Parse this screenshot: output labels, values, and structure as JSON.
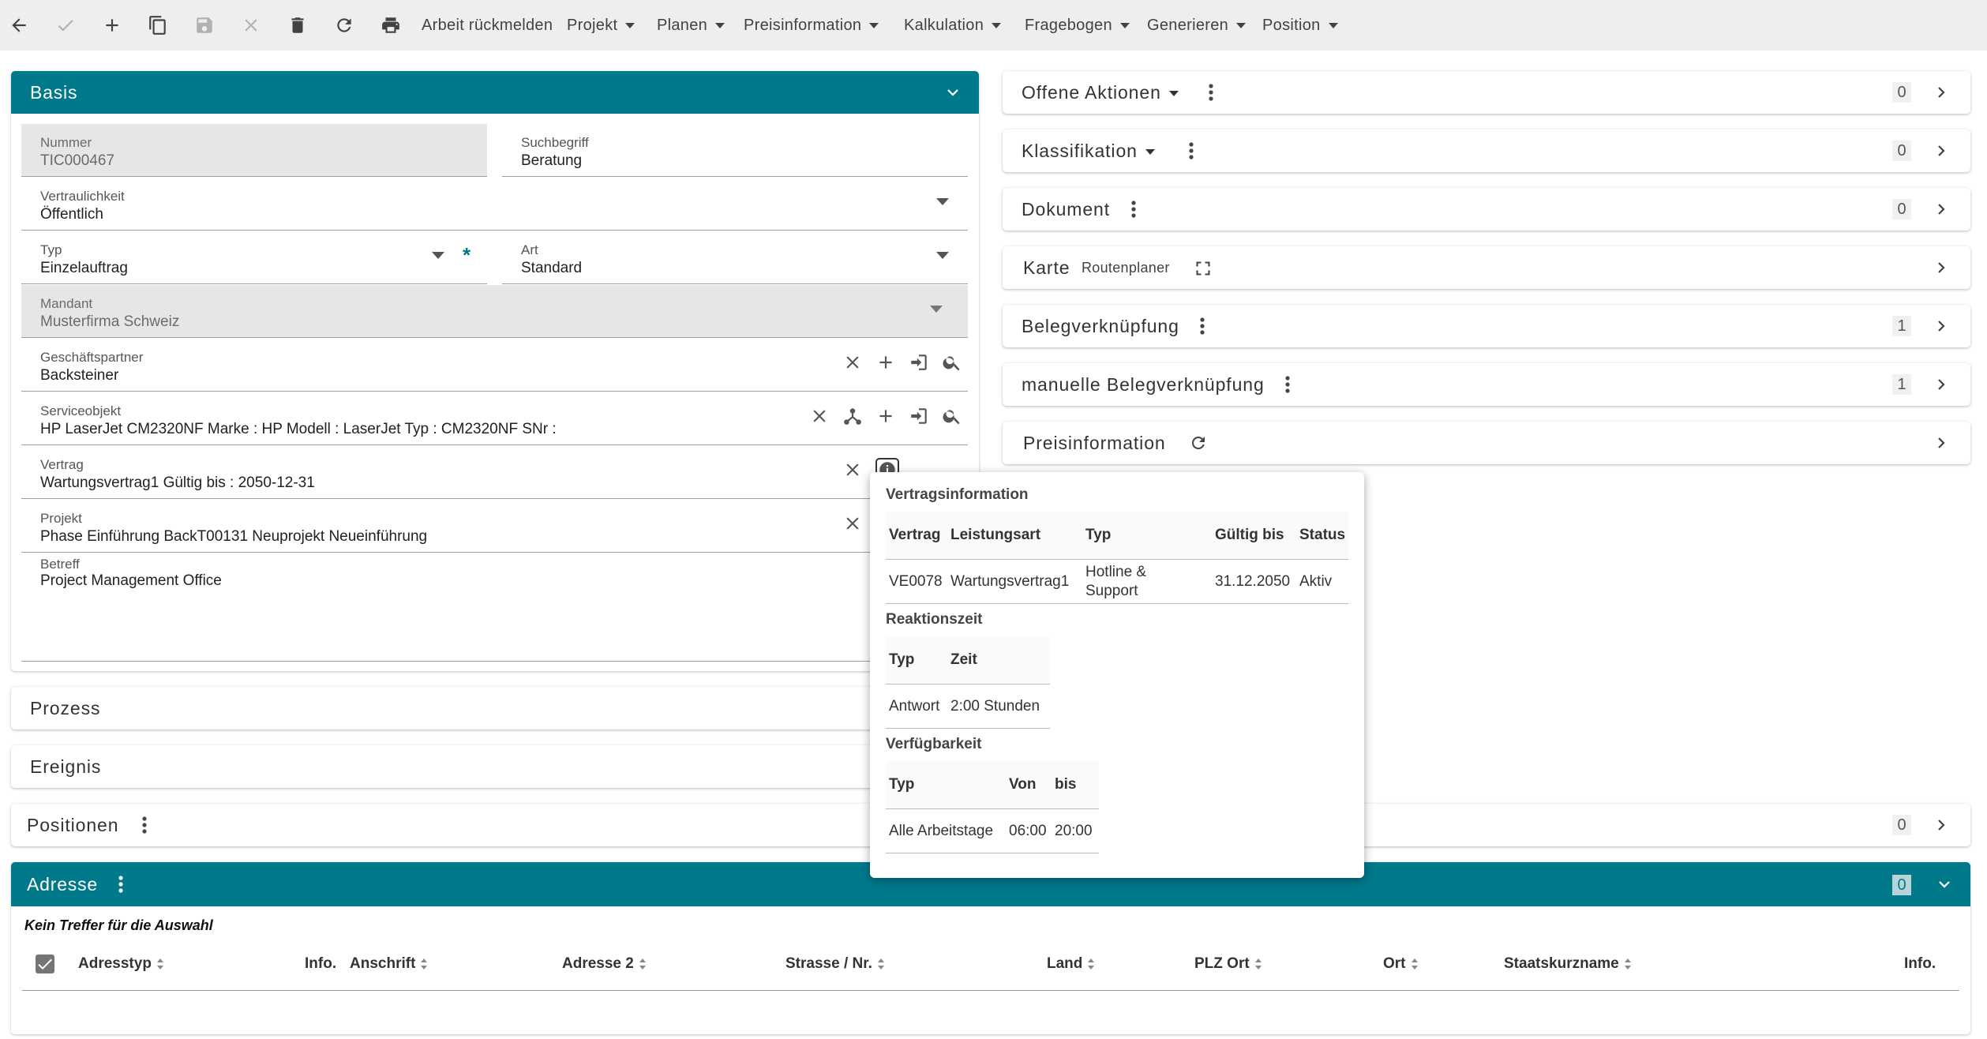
{
  "toolbar": {
    "menus": [
      "Arbeit rückmelden",
      "Projekt",
      "Planen",
      "Preisinformation",
      "Kalkulation",
      "Fragebogen",
      "Generieren",
      "Position"
    ]
  },
  "basis": {
    "title": "Basis",
    "nummer": {
      "label": "Nummer",
      "value": "TIC000467"
    },
    "suchbegriff": {
      "label": "Suchbegriff",
      "value": "Beratung"
    },
    "vertraulichkeit": {
      "label": "Vertraulichkeit",
      "value": "Öffentlich"
    },
    "typ": {
      "label": "Typ",
      "value": "Einzelauftrag",
      "required": "*"
    },
    "art": {
      "label": "Art",
      "value": "Standard"
    },
    "mandant": {
      "label": "Mandant",
      "value": "Musterfirma Schweiz"
    },
    "geschaeftspartner": {
      "label": "Geschäftspartner",
      "value": "Backsteiner"
    },
    "serviceobjekt": {
      "label": "Serviceobjekt",
      "value": "HP LaserJet CM2320NF Marke : HP Modell : LaserJet Typ : CM2320NF SNr :"
    },
    "vertrag": {
      "label": "Vertrag",
      "value": "Wartungsvertrag1 Gültig bis : 2050-12-31"
    },
    "projekt": {
      "label": "Projekt",
      "value": "Phase Einführung BackT00131 Neuprojekt Neueinführung"
    },
    "betreff": {
      "label": "Betreff",
      "value": "Project Management Office"
    }
  },
  "left_panels": {
    "prozess": "Prozess",
    "ereignis": "Ereignis",
    "positionen": {
      "title": "Positionen",
      "count": "0"
    }
  },
  "right_panels": [
    {
      "title": "Offene Aktionen",
      "count": "0"
    },
    {
      "title": "Klassifikation",
      "count": "0"
    },
    {
      "title": "Dokument",
      "count": "0"
    },
    {
      "title": "Karte",
      "sub": "Routenplaner"
    },
    {
      "title": "Belegverknüpfung",
      "count": "1"
    },
    {
      "title": "manuelle Belegverknüpfung",
      "count": "1"
    },
    {
      "title": "Preisinformation"
    }
  ],
  "adresse": {
    "title": "Adresse",
    "count": "0",
    "empty_text": "Kein Treffer für die Auswahl",
    "columns": [
      "Adresstyp",
      "Info.",
      "Anschrift",
      "Adresse 2",
      "Strasse / Nr.",
      "Land",
      "PLZ Ort",
      "Ort",
      "Staatskurzname",
      "Info."
    ]
  },
  "popover": {
    "vertrag_title": "Vertragsinformation",
    "vertrag_headers": [
      "Vertrag",
      "Leistungsart",
      "Typ",
      "Gültig bis",
      "Status"
    ],
    "vertrag_row": [
      "VE0078",
      "Wartungsvertrag1",
      "Hotline &",
      "Support",
      "31.12.2050",
      "Aktiv"
    ],
    "reaktion_title": "Reaktionszeit",
    "reaktion_headers": [
      "Typ",
      "Zeit"
    ],
    "reaktion_row": [
      "Antwort",
      "2:00 Stunden"
    ],
    "verf_title": "Verfügbarkeit",
    "verf_headers": [
      "Typ",
      "Von",
      "bis"
    ],
    "verf_row": [
      "Alle Arbeitstage",
      "06:00",
      "20:00"
    ]
  },
  "colors": {
    "accent": "#00798b",
    "toolbar_bg": "#eeeeee",
    "readonly_bg": "#e6e6e6"
  }
}
